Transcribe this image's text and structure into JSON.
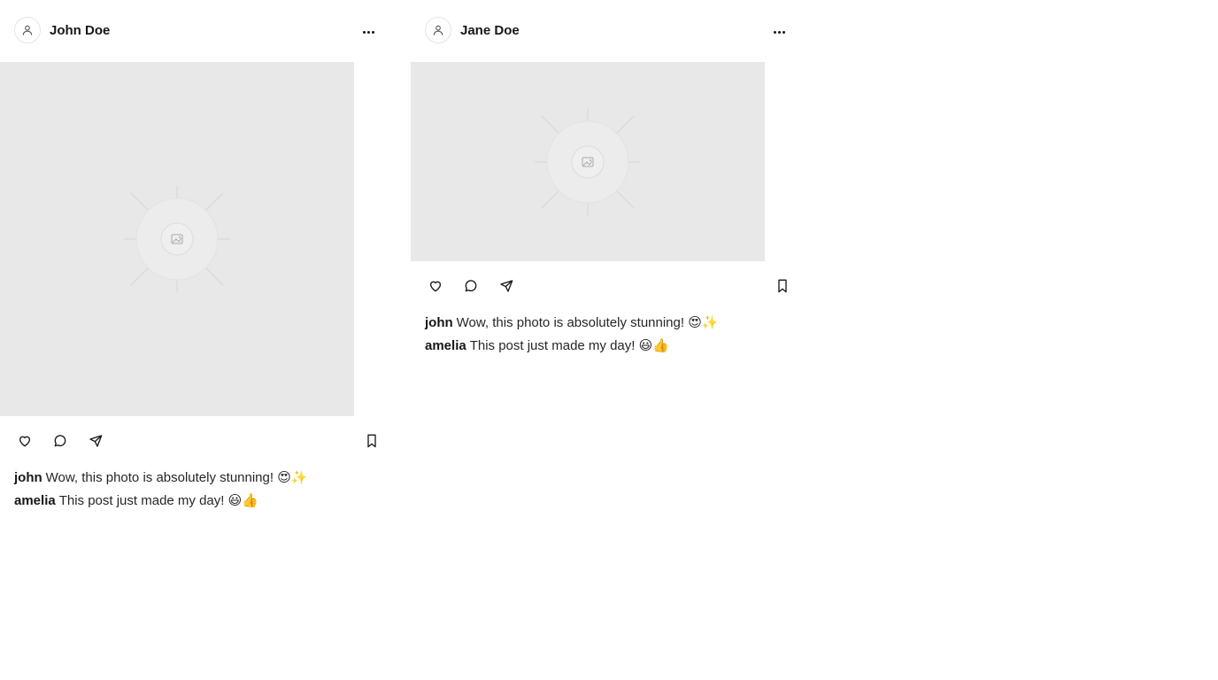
{
  "posts": [
    {
      "username": "John Doe",
      "comments": [
        {
          "author": "john",
          "text": "Wow, this photo is absolutely stunning! 😍✨"
        },
        {
          "author": "amelia",
          "text": "This post just made my day! 😃👍"
        }
      ]
    },
    {
      "username": "Jane Doe",
      "comments": [
        {
          "author": "john",
          "text": "Wow, this photo is absolutely stunning! 😍✨"
        },
        {
          "author": "amelia",
          "text": "This post just made my day! 😃👍"
        }
      ]
    }
  ],
  "icons": {
    "avatar": "user-icon",
    "more": "ellipsis-icon",
    "like": "heart-icon",
    "comment": "comment-bubble-icon",
    "share": "send-icon",
    "save": "bookmark-icon",
    "media": "image-placeholder-icon"
  },
  "colors": {
    "text": "#171717",
    "media_bg": "#e8e8e8",
    "border": "#e5e5e5"
  }
}
